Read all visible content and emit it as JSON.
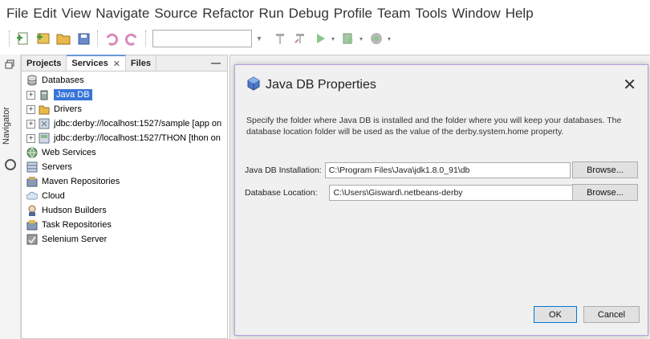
{
  "menubar": {
    "items": [
      "File",
      "Edit",
      "View",
      "Navigate",
      "Source",
      "Refactor",
      "Run",
      "Debug",
      "Profile",
      "Team",
      "Tools",
      "Window",
      "Help"
    ]
  },
  "toolbar": {
    "icons": [
      "new-file-icon",
      "new-project-icon",
      "open-project-icon",
      "save-all-icon",
      "undo-icon",
      "redo-icon",
      "hammer-icon",
      "clean-build-icon",
      "run-icon",
      "debug-icon",
      "profile-icon"
    ],
    "config_combo_value": ""
  },
  "leftstrip": {
    "navigator_label": "Navigator"
  },
  "panel": {
    "tabs": [
      {
        "label": "Projects",
        "close": ""
      },
      {
        "label": "Services",
        "close": "✕"
      },
      {
        "label": "Files",
        "close": ""
      }
    ],
    "minimize": "—",
    "tree": [
      {
        "label": "Databases",
        "icon": "database-icon",
        "level": 0,
        "expander": ""
      },
      {
        "label": "Java DB",
        "icon": "javadb-icon",
        "level": 1,
        "expander": "+",
        "selected": true
      },
      {
        "label": "Drivers",
        "icon": "drivers-icon",
        "level": 1,
        "expander": "+"
      },
      {
        "label": "jdbc:derby://localhost:1527/sample [app on",
        "icon": "connection-icon",
        "level": 1,
        "expander": "+"
      },
      {
        "label": "jdbc:derby://localhost:1527/THON [thon on",
        "icon": "connection-icon",
        "level": 1,
        "expander": "+"
      },
      {
        "label": "Web Services",
        "icon": "web-services-icon",
        "level": 0,
        "expander": ""
      },
      {
        "label": "Servers",
        "icon": "servers-icon",
        "level": 0,
        "expander": ""
      },
      {
        "label": "Maven Repositories",
        "icon": "maven-icon",
        "level": 0,
        "expander": ""
      },
      {
        "label": "Cloud",
        "icon": "cloud-icon",
        "level": 0,
        "expander": ""
      },
      {
        "label": "Hudson Builders",
        "icon": "hudson-icon",
        "level": 0,
        "expander": ""
      },
      {
        "label": "Task Repositories",
        "icon": "task-repo-icon",
        "level": 0,
        "expander": ""
      },
      {
        "label": "Selenium Server",
        "icon": "selenium-icon",
        "level": 0,
        "expander": ""
      }
    ]
  },
  "dialog": {
    "title": "Java DB Properties",
    "close": "✕",
    "description": "Specify the folder where Java DB is installed and the folder where you will keep your databases. The database location folder will be used as the value of the derby.system.home property.",
    "installation_label": "Java DB Installation:",
    "installation_value": "C:\\Program Files\\Java\\jdk1.8.0_91\\db",
    "location_label": "Database Location:",
    "location_value": "C:\\Users\\Gisward\\.netbeans-derby",
    "browse_label": "Browse...",
    "ok_label": "OK",
    "cancel_label": "Cancel"
  },
  "colors": {
    "selection": "#3875d7",
    "dialog_border": "#b4a0d8",
    "default_button_border": "#0078d7"
  }
}
